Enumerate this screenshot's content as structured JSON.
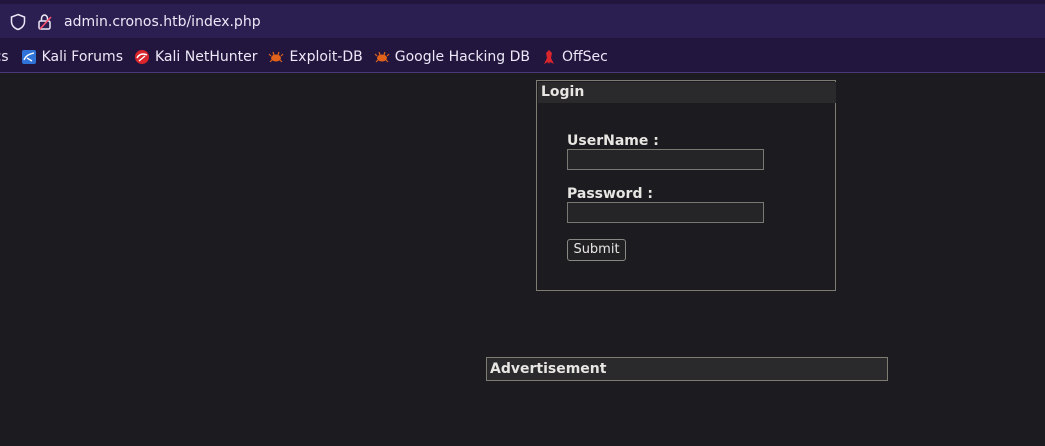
{
  "browser": {
    "url": "admin.cronos.htb/index.php",
    "bookmarks": [
      {
        "label": "ocs",
        "icon": "truncated"
      },
      {
        "label": "Kali Forums",
        "icon": "kali-forums-icon"
      },
      {
        "label": "Kali NetHunter",
        "icon": "kali-nethunter-icon"
      },
      {
        "label": "Exploit-DB",
        "icon": "exploit-db-icon"
      },
      {
        "label": "Google Hacking DB",
        "icon": "ghdb-icon"
      },
      {
        "label": "OffSec",
        "icon": "offsec-icon"
      }
    ]
  },
  "login": {
    "legend": "Login",
    "username_label": "UserName :",
    "username_value": "",
    "password_label": "Password :",
    "password_value": "",
    "submit_label": "Submit"
  },
  "advertisement": {
    "legend": "Advertisement"
  },
  "colors": {
    "page_bg": "#1c1b1f",
    "chrome_bg": "#22153e",
    "urlbar_bg": "#2b1f52",
    "text": "#e8e6e3"
  }
}
